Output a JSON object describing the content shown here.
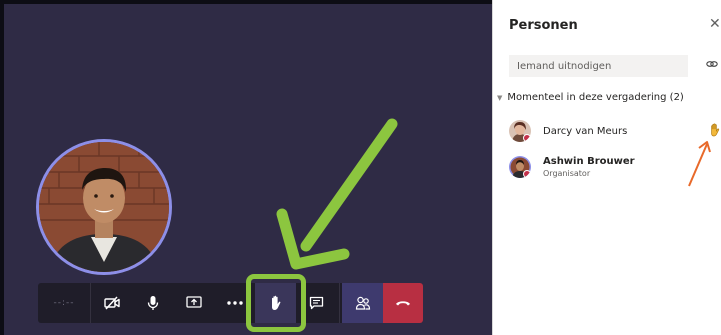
{
  "meeting": {
    "timer": "--:--",
    "controls": [
      {
        "id": "camera",
        "icon": "camera-off-icon"
      },
      {
        "id": "mic",
        "icon": "microphone-icon"
      },
      {
        "id": "share",
        "icon": "share-screen-icon"
      },
      {
        "id": "more",
        "icon": "more-actions-icon"
      },
      {
        "id": "raise-hand",
        "icon": "raise-hand-icon"
      },
      {
        "id": "chat",
        "icon": "chat-icon"
      },
      {
        "id": "participants",
        "icon": "participants-icon"
      },
      {
        "id": "hangup",
        "icon": "hang-up-icon"
      }
    ],
    "colors": {
      "stage": "#2f2b45",
      "control_bar": "#1f1d29",
      "active_control": "#3e3a6e",
      "hangup": "#b82f42",
      "avatar_ring": "#8d8fe8",
      "annotation_green": "#8cc63f",
      "annotation_orange": "#e8692a"
    }
  },
  "panel": {
    "title": "Personen",
    "close_icon": "close-icon",
    "invite_placeholder": "Iemand uitnodigen",
    "share_icon": "share-link-icon",
    "section_label": "Momenteel in deze vergadering (2)",
    "participants": [
      {
        "name": "Darcy van Meurs",
        "role": "",
        "status": "busy",
        "hand_raised": true
      },
      {
        "name": "Ashwin Brouwer",
        "role": "Organisator",
        "status": "busy",
        "hand_raised": false
      }
    ]
  }
}
